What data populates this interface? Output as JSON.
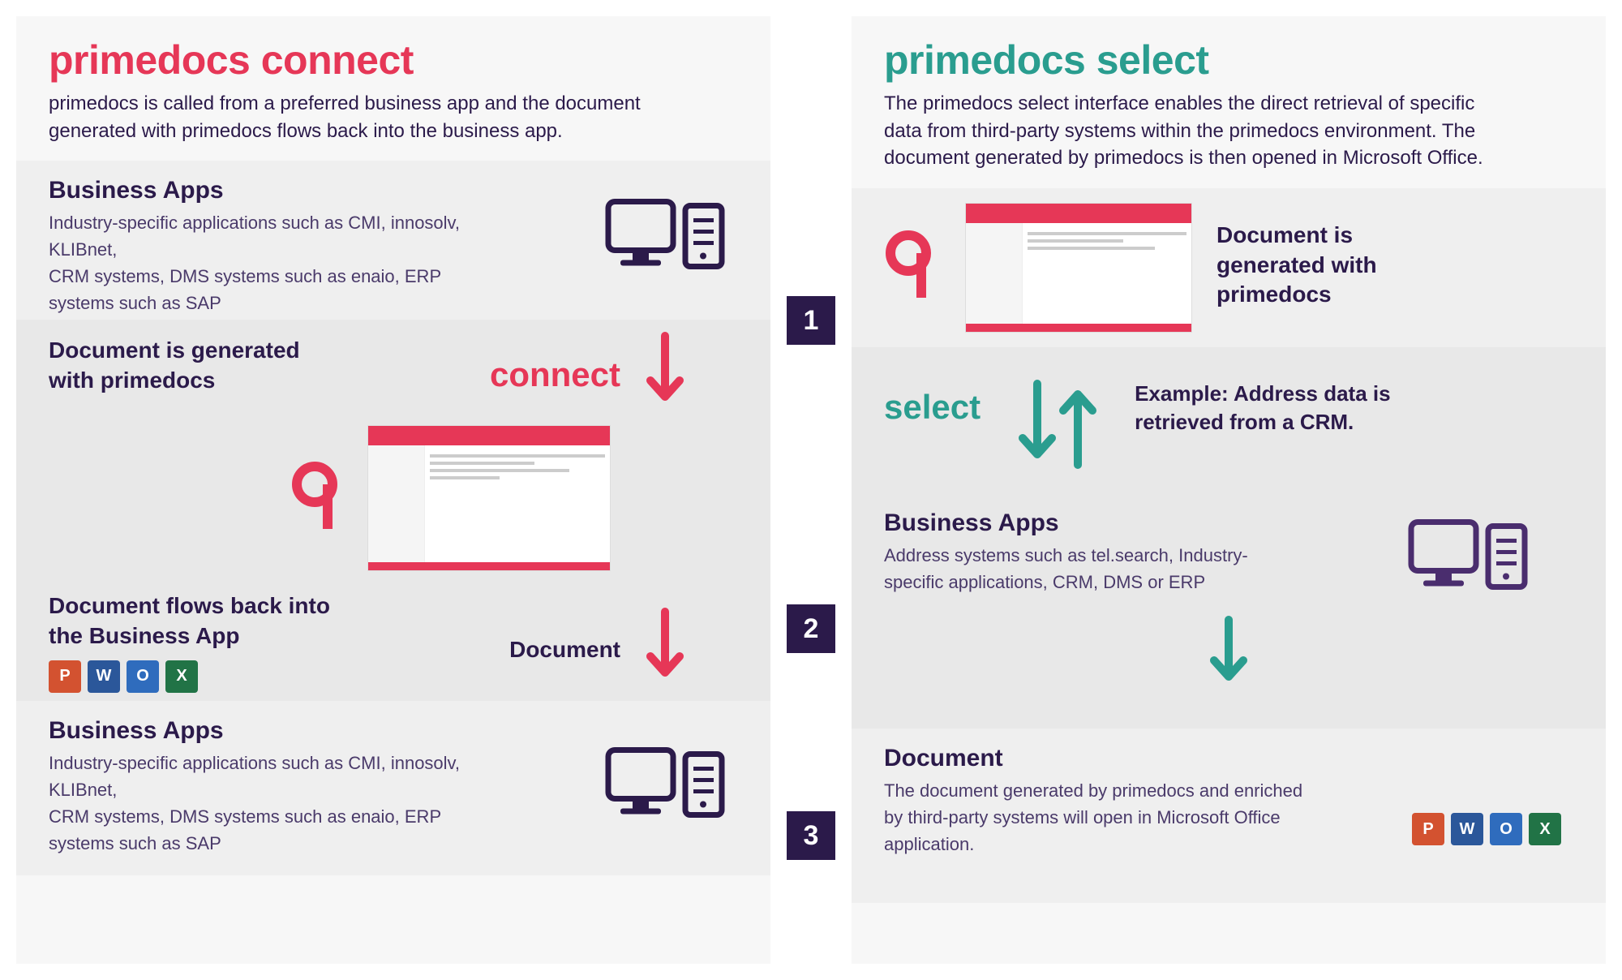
{
  "connect": {
    "title": "primedocs connect",
    "desc": "primedocs is called from a preferred business app and the document generated with primedocs flows back into the business app.",
    "band1": {
      "title": "Business Apps",
      "text": "Industry-specific applications such as CMI, innosolv, KLIBnet,\nCRM systems, DMS systems such as enaio, ERP systems such as SAP"
    },
    "mid": {
      "gen_title": "Document is generated with primedocs",
      "flow_label": "connect",
      "back_title": "Document flows back into the Business App",
      "doc_label": "Document"
    },
    "band3": {
      "title": "Business Apps",
      "text": "Industry-specific applications such as CMI, innosolv, KLIBnet,\nCRM systems, DMS systems such as enaio, ERP systems such as SAP"
    }
  },
  "select": {
    "title": "primedocs select",
    "desc": "The primedocs select interface enables the direct retrieval of specific data from third-party systems within the primedocs environment. The document generated by primedocs is  then opened in Microsoft Office.",
    "band1": {
      "right_text": "Document is generated with primedocs"
    },
    "mid": {
      "flow_label": "select",
      "example": "Example: Address data is retrieved from a CRM.",
      "biz_title": "Business Apps",
      "biz_text": "Address systems such as tel.search, Industry-specific applications, CRM, DMS or ERP"
    },
    "band3": {
      "title": "Document",
      "text": "The document generated by primedocs and enriched by third-party systems will open in Microsoft Office application."
    }
  },
  "steps": {
    "s1": "1",
    "s2": "2",
    "s3": "3"
  },
  "office": {
    "p": "P",
    "w": "W",
    "o": "O",
    "x": "X"
  }
}
